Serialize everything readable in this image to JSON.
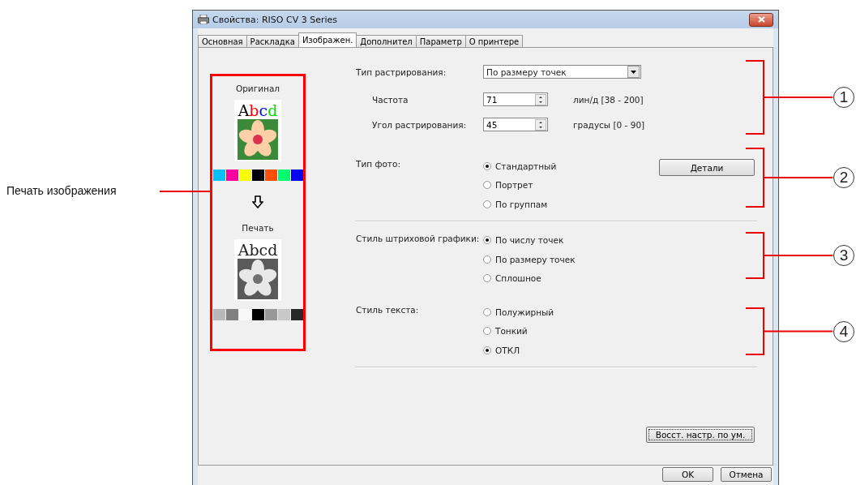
{
  "window": {
    "title": "Свойства: RISO CV 3 Series"
  },
  "tabs": [
    {
      "label": "Основная",
      "selected": false
    },
    {
      "label": "Раскладка",
      "selected": false
    },
    {
      "label": "Изображен.",
      "selected": true
    },
    {
      "label": "Дополнител",
      "selected": false
    },
    {
      "label": "Параметр",
      "selected": false
    },
    {
      "label": "О принтере",
      "selected": false
    }
  ],
  "preview": {
    "original_label": "Оригинал",
    "original_letters": [
      {
        "text": "A",
        "color": "#000000"
      },
      {
        "text": "b",
        "color": "#ff0000"
      },
      {
        "text": "c",
        "color": "#0000ff"
      },
      {
        "text": "d",
        "color": "#00e000"
      }
    ],
    "original_swatches": [
      {
        "color": "#00c0ff"
      },
      {
        "color": "#ff00a0"
      },
      {
        "color": "#ffff00"
      },
      {
        "color": "#000000"
      },
      {
        "color": "#ff5000"
      },
      {
        "color": "#00ff70"
      },
      {
        "color": "#0000ff"
      }
    ],
    "print_label": "Печать",
    "print_text": "Abcd",
    "print_swatches": [
      {
        "color": "#b8b8b8"
      },
      {
        "color": "#808080"
      },
      {
        "color": "#f8f8f8"
      },
      {
        "color": "#000000"
      },
      {
        "color": "#989898"
      },
      {
        "color": "#c8c8c8"
      },
      {
        "color": "#282828"
      }
    ]
  },
  "screening": {
    "label": "Тип растрирования:",
    "value": "По размеру точек",
    "fields": [
      {
        "label": "Частота",
        "value": "71",
        "range": "лин/д [38 - 200]"
      },
      {
        "label": "Угол растрирования:",
        "value": "45",
        "range": "градусы [0 - 90]"
      }
    ]
  },
  "photo_type": {
    "label": "Тип фото:",
    "details_button": "Детали",
    "options": [
      {
        "label": "Стандартный",
        "selected": true
      },
      {
        "label": "Портрет",
        "selected": false
      },
      {
        "label": "По группам",
        "selected": false
      }
    ]
  },
  "line_art": {
    "label": "Стиль штриховой графики:",
    "options": [
      {
        "label": "По числу точек",
        "selected": true
      },
      {
        "label": "По размеру точек",
        "selected": false
      },
      {
        "label": "Сплошное",
        "selected": false
      }
    ]
  },
  "text_style": {
    "label": "Стиль текста:",
    "options": [
      {
        "label": "Полужирный",
        "selected": false
      },
      {
        "label": "Тонкий",
        "selected": false
      },
      {
        "label": "ОТКЛ",
        "selected": true
      }
    ]
  },
  "reset_button": "Восст. настр. по ум.",
  "buttons": [
    "OK",
    "Отмена"
  ],
  "annotations": {
    "left_label": "Печать изображения",
    "callouts": [
      "1",
      "2",
      "3",
      "4"
    ]
  }
}
